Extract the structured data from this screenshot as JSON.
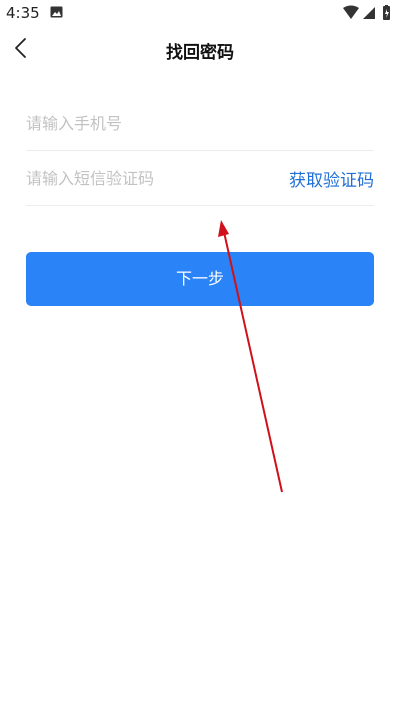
{
  "status_bar": {
    "time": "4:35"
  },
  "header": {
    "title": "找回密码",
    "back_icon": "chevron-left-icon"
  },
  "form": {
    "phone_placeholder": "请输入手机号",
    "code_placeholder": "请输入短信验证码",
    "get_code_label": "获取验证码"
  },
  "next_button_label": "下一步",
  "colors": {
    "accent": "#2a83f7",
    "link": "#1f6fd6",
    "annotation_arrow": "#d0101a"
  }
}
